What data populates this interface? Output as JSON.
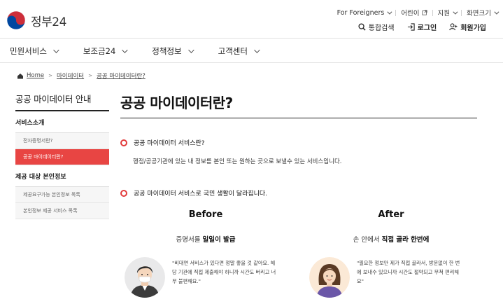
{
  "header": {
    "logo_text": "정부24",
    "util": {
      "foreigners": "For Foreigners",
      "kids": "어린이",
      "support": "지원",
      "screen_size": "화면크기"
    },
    "actions": {
      "search": "통합검색",
      "login": "로그인",
      "signup": "회원가입"
    }
  },
  "nav": {
    "items": [
      "민원서비스",
      "보조금24",
      "정책정보",
      "고객센터"
    ]
  },
  "breadcrumb": {
    "home": "Home",
    "level1": "마이데이터",
    "level2": "공공 마이데이터란?"
  },
  "side": {
    "title": "공공 마이데이터 안내",
    "group1": "서비스소개",
    "group1_items": [
      "전자증명서란?",
      "공공 마이데이터란?"
    ],
    "group2": "제공 대상 본인정보",
    "group2_items": [
      "제공요구가능 본인정보 목록",
      "본인정보 제공 서비스 목록"
    ]
  },
  "main": {
    "title": "공공 마이데이터란?",
    "section1_title": "공공 마이데이터 서비스란?",
    "section1_desc": "행정/공공기관에 있는 내 정보를 본인 또는 원하는 곳으로 보낼수 있는 서비스입니다.",
    "section2_title": "공공 마이데이터 서비스로 국민 생활이 달라집니다.",
    "before": {
      "heading": "Before",
      "sub_pre": "증명서를 ",
      "sub_bold": "일일이 발급",
      "quote_lines": [
        "\"비대면 서비스가 있다면 정말 좋을 것 같아요. 해",
        "당 기관에 직접 제출해야 하니까 시간도 버리고 너",
        "무 불편해요.\""
      ]
    },
    "after": {
      "heading": "After",
      "sub_pre": "손 안에서 ",
      "sub_bold": "직접 골라 한번에",
      "quote_lines": [
        "\"필요한 정보만 제가 직접 골라서, 방문없이 한 번",
        "에 보내수 있으니까 시간도 절약되고 무척 편리해",
        "요\""
      ]
    }
  },
  "colors": {
    "accent": "#e84543",
    "logo_red": "#cd2e3a",
    "logo_blue": "#0047a0"
  }
}
